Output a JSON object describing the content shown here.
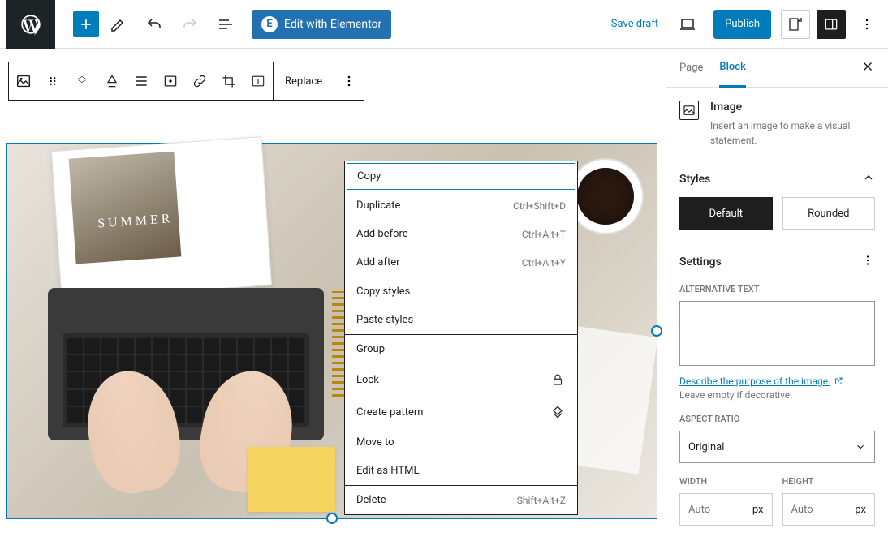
{
  "topbar": {
    "elementor_label": "Edit with Elementor",
    "save_draft": "Save draft",
    "publish": "Publish"
  },
  "block_toolbar": {
    "replace": "Replace"
  },
  "ctx": {
    "copy": "Copy",
    "duplicate": "Duplicate",
    "duplicate_kbd": "Ctrl+Shift+D",
    "add_before": "Add before",
    "add_before_kbd": "Ctrl+Alt+T",
    "add_after": "Add after",
    "add_after_kbd": "Ctrl+Alt+Y",
    "copy_styles": "Copy styles",
    "paste_styles": "Paste styles",
    "group": "Group",
    "lock": "Lock",
    "create_pattern": "Create pattern",
    "move_to": "Move to",
    "edit_html": "Edit as HTML",
    "delete": "Delete",
    "delete_kbd": "Shift+Alt+Z"
  },
  "sidebar": {
    "tabs": {
      "page": "Page",
      "block": "Block"
    },
    "header": {
      "title": "Image",
      "desc": "Insert an image to make a visual statement."
    },
    "styles": {
      "title": "Styles",
      "default": "Default",
      "rounded": "Rounded"
    },
    "settings": {
      "title": "Settings",
      "alt_label": "Alternative Text",
      "alt_value": "",
      "purpose_link": "Describe the purpose of the image.",
      "hint": "Leave empty if decorative.",
      "aspect_label": "Aspect Ratio",
      "aspect_value": "Original",
      "width_label": "Width",
      "width_value": "Auto",
      "width_unit": "px",
      "height_label": "Height",
      "height_value": "Auto",
      "height_unit": "px"
    }
  },
  "magazine_text": "SUMMER"
}
